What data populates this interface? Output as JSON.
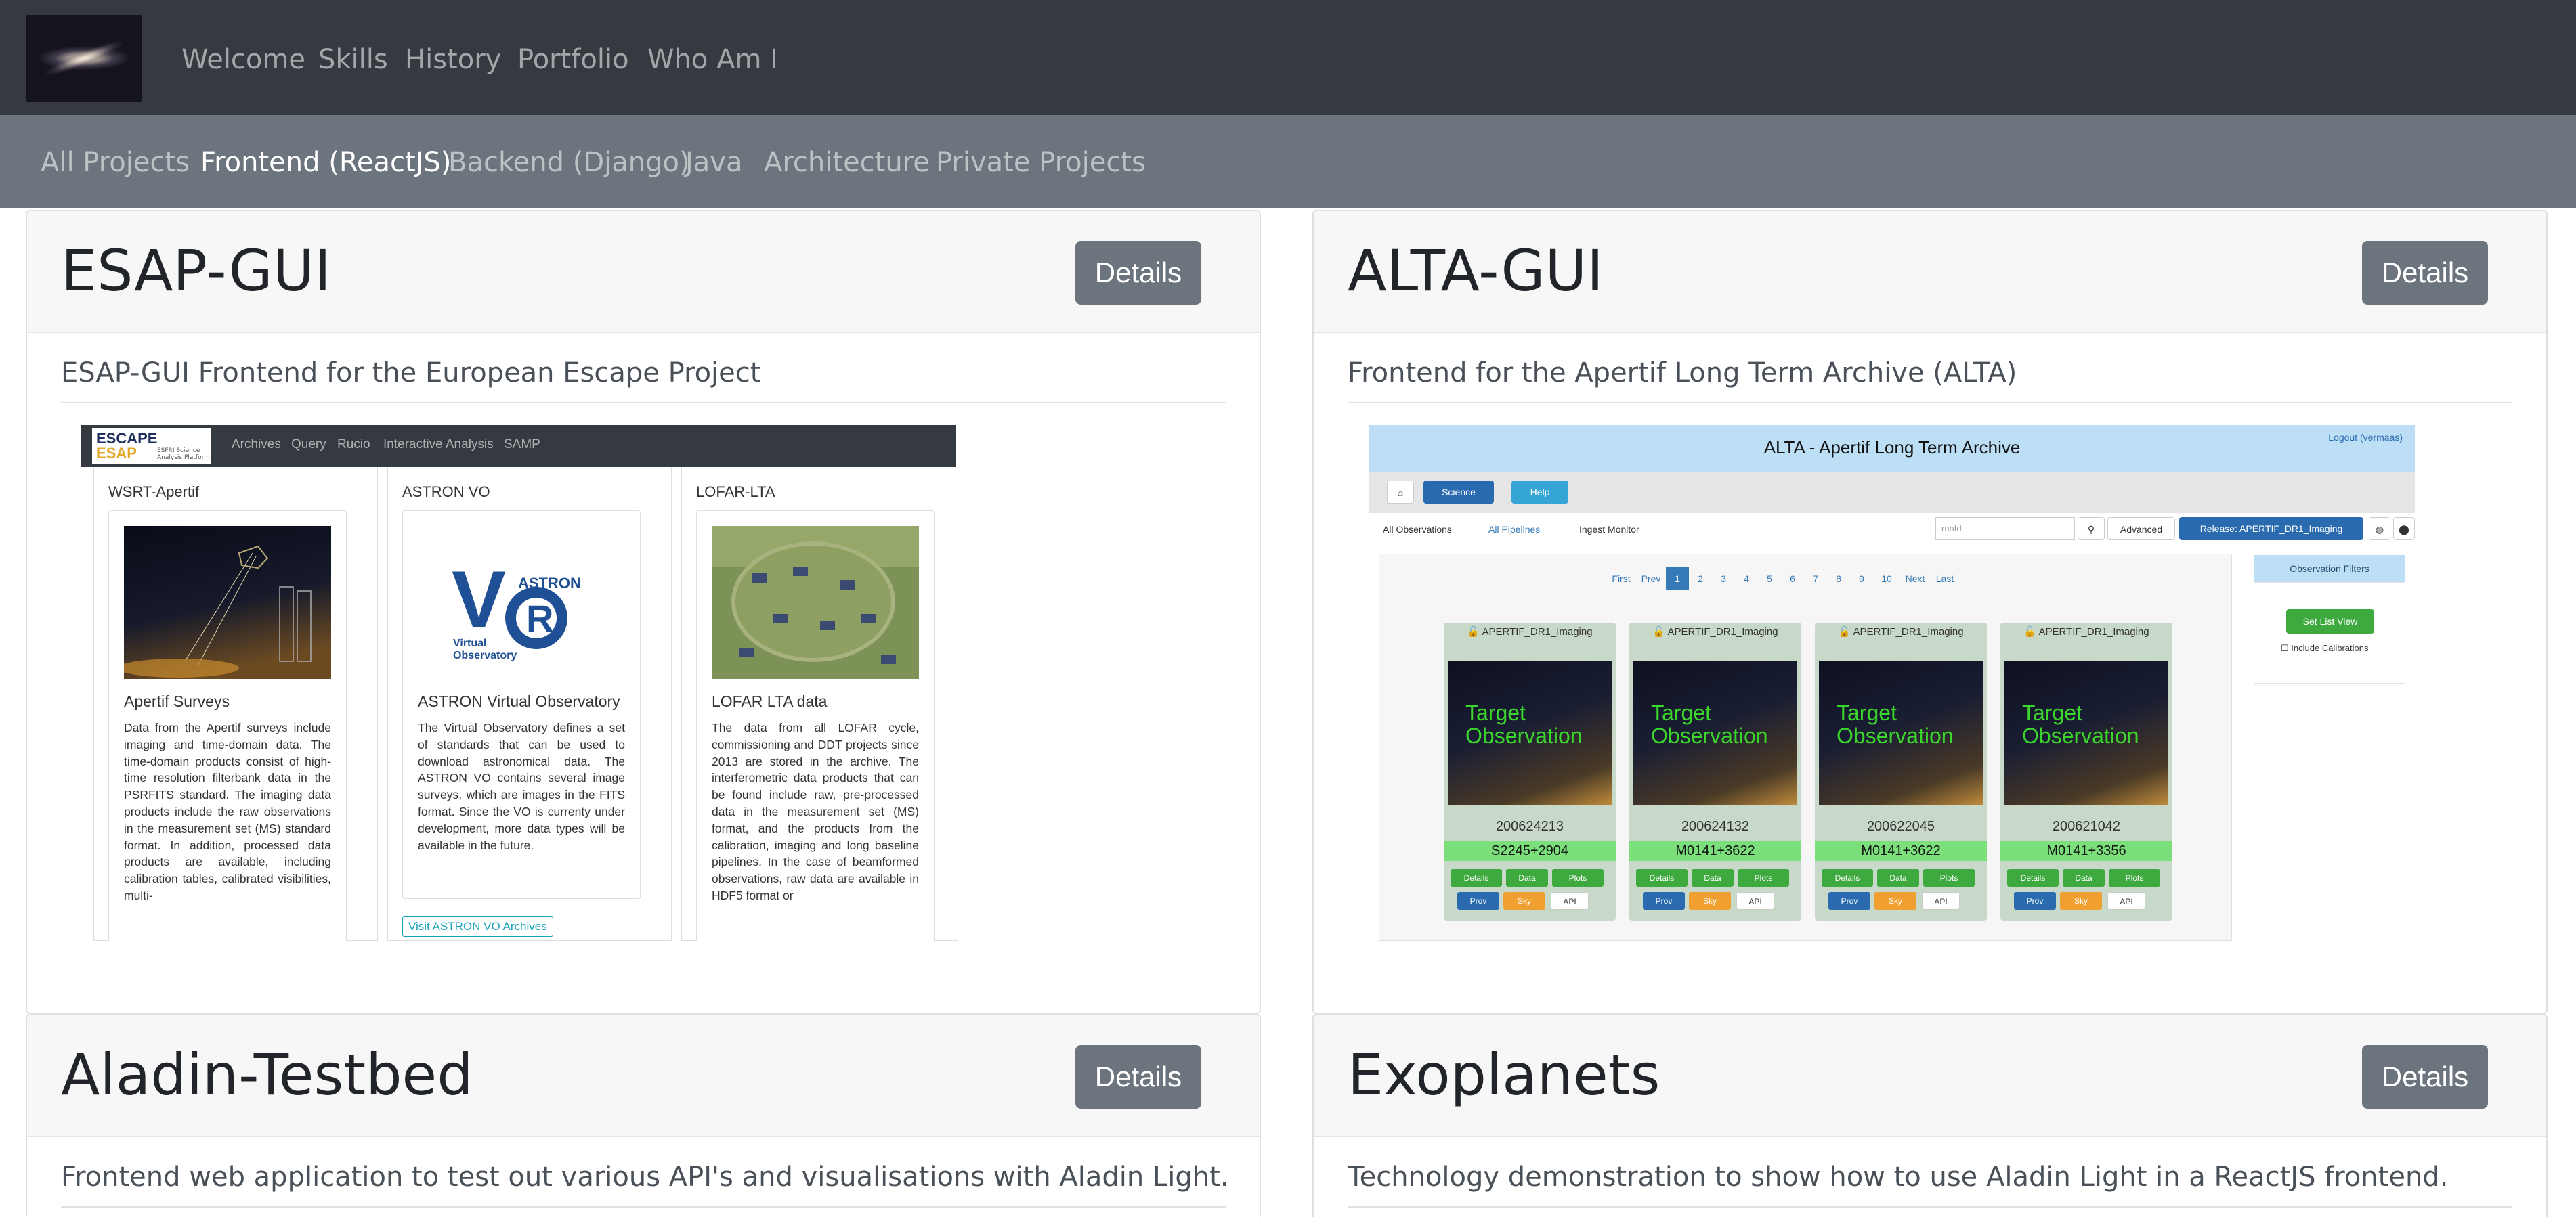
{
  "top_nav": {
    "items": [
      "Welcome",
      "Skills",
      "History",
      "Portfolio",
      "Who Am I"
    ]
  },
  "sub_nav": {
    "items": [
      "All Projects",
      "Frontend (ReactJS)",
      "Backend (Django)",
      "Java",
      "Architecture",
      "Private Projects"
    ],
    "active": "Frontend (ReactJS)"
  },
  "projects": [
    {
      "title": "ESAP-GUI",
      "button": "Details",
      "description": "ESAP-GUI Frontend for the European Escape Project",
      "screenshot": {
        "logo_top": "ESCAPE",
        "logo_bottom": "ESAP",
        "logo_sub": "ESFRI Science Analysis Platform",
        "nav": [
          "Archives",
          "Query",
          "Rucio",
          "Interactive Analysis",
          "SAMP"
        ],
        "columns": [
          {
            "heading": "WSRT-Apertif",
            "title": "Apertif Surveys",
            "text": "Data from the Apertif surveys include imaging and time-domain data. The time-domain products consist of high-time resolution filterbank data in the PSRFITS standard. The imaging data products include the raw observations in the measurement set (MS) standard format. In addition, processed data products are available, including calibration tables, calibrated visibilities, multi-"
          },
          {
            "heading": "ASTRON VO",
            "title": "ASTRON Virtual Observatory",
            "logo_text_1": "ASTRON",
            "logo_text_2": "Virtual",
            "logo_text_3": "Observatory",
            "text": "The Virtual Observatory defines a set of standards that can be used to download astronomical data. The ASTRON VO contains several image surveys, which are images in the FITS format. Since the VO is currenty under development, more data types will be available in the future.",
            "link": "Visit ASTRON VO Archives"
          },
          {
            "heading": "LOFAR-LTA",
            "title": "LOFAR LTA data",
            "text": "The data from all LOFAR cycle, commissioning and DDT projects since 2013 are stored in the archive. The interferometric data products that can be found include raw, pre-processed data in the measurement set (MS) format, and the products from the calibration, imaging and long baseline pipelines. In the case of beamformed observations, raw data are available in HDF5 format or"
          }
        ]
      }
    },
    {
      "title": "ALTA-GUI",
      "button": "Details",
      "description": "Frontend for the Apertif Long Term Archive (ALTA)",
      "screenshot": {
        "header": "ALTA - Apertif Long Term Archive",
        "logout": "Logout (vermaas)",
        "science": "Science",
        "help": "Help",
        "tabs": [
          "All Observations",
          "All Pipelines",
          "Ingest Monitor"
        ],
        "search_placeholder": "runId",
        "advanced": "Advanced",
        "release": "Release: APERTIF_DR1_Imaging",
        "pagination": [
          "First",
          "Prev",
          "1",
          "2",
          "3",
          "4",
          "5",
          "6",
          "7",
          "8",
          "9",
          "10",
          "Next",
          "Last"
        ],
        "filters_title": "Observation Filters",
        "set_list_view": "Set List View",
        "include_calibrations": "Include Calibrations",
        "card_release": "APERTIF_DR1_Imaging",
        "image_text": "Target Observation",
        "buttons": [
          "Details",
          "Data",
          "Plots",
          "Prov",
          "Sky",
          "API"
        ],
        "observations": [
          {
            "id": "200624213",
            "name": "S2245+2904"
          },
          {
            "id": "200624132",
            "name": "M0141+3622"
          },
          {
            "id": "200622045",
            "name": "M0141+3622"
          },
          {
            "id": "200621042",
            "name": "M0141+3356"
          }
        ]
      }
    },
    {
      "title": "Aladin-Testbed",
      "button": "Details",
      "description": "Frontend web application to test out various API's and visualisations with Aladin Light."
    },
    {
      "title": "Exoplanets",
      "button": "Details",
      "description": "Technology demonstration to show how to use Aladin Light in a ReactJS frontend."
    }
  ],
  "colors": {
    "top_nav_bg": "#343a40",
    "sub_nav_bg": "#6c757d",
    "button_bg": "#6c757d",
    "alta_header_bg": "#bcdff6",
    "alta_name_bg": "#7be07b"
  }
}
